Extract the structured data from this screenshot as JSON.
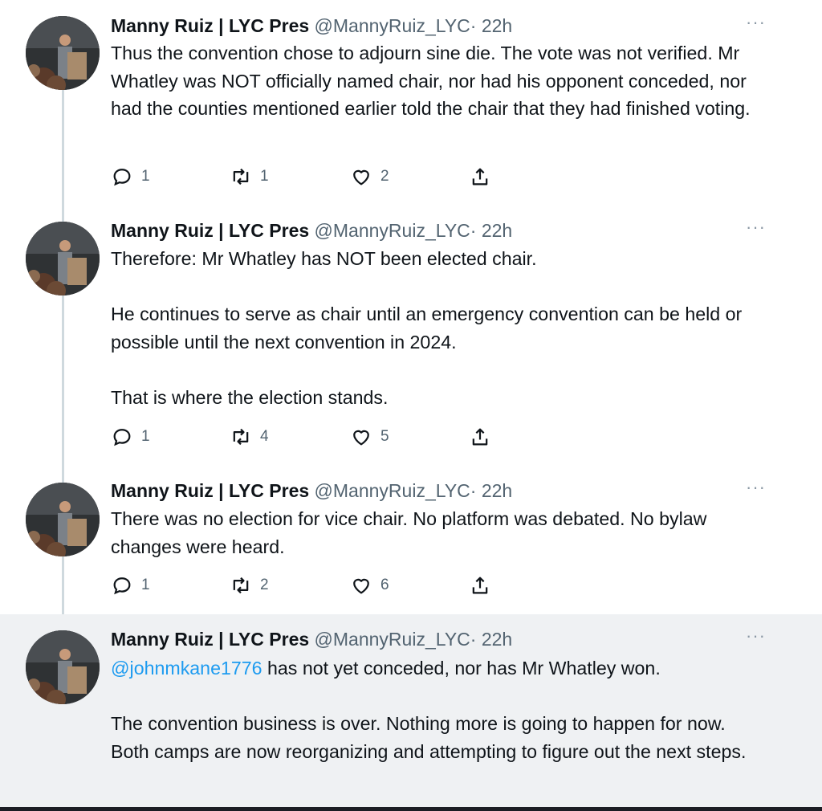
{
  "tweets": [
    {
      "author": "Manny Ruiz | LYC Pres",
      "handle": "@MannyRuiz_LYC",
      "time": "· 22h",
      "paragraphs": [
        "Thus the convention chose to adjourn sine die. The vote was not verified. Mr Whatley was NOT officially named chair, nor had his opponent conceded, nor had the counties mentioned earlier told the chair that they had finished voting."
      ],
      "replies": "1",
      "retweets": "1",
      "likes": "2"
    },
    {
      "author": "Manny Ruiz | LYC Pres",
      "handle": "@MannyRuiz_LYC",
      "time": "· 22h",
      "paragraphs": [
        "Therefore: Mr Whatley has NOT been elected chair.",
        "He continues to serve as chair until an emergency convention can be held or possible until the next convention in 2024.",
        "That is where the election stands."
      ],
      "replies": "1",
      "retweets": "4",
      "likes": "5"
    },
    {
      "author": "Manny Ruiz | LYC Pres",
      "handle": "@MannyRuiz_LYC",
      "time": "· 22h",
      "paragraphs": [
        "There was no election for vice chair. No platform was debated. No bylaw changes were heard."
      ],
      "replies": "1",
      "retweets": "2",
      "likes": "6"
    },
    {
      "author": "Manny Ruiz | LYC Pres",
      "handle": "@MannyRuiz_LYC",
      "time": "· 22h",
      "mention": "@johnmkane1776",
      "paragraphs": [
        " has not yet conceded, nor has Mr Whatley won.",
        "The convention business is over. Nothing more is going to happen for now. Both camps are now reorganizing and attempting to figure out the next steps."
      ]
    }
  ],
  "icons": {
    "more": "more-horizontal-icon",
    "reply": "reply-bubble-icon",
    "retweet": "retweet-arrows-icon",
    "like": "heart-outline-icon",
    "share": "share-upload-icon"
  },
  "colors": {
    "link": "#1d9bf0",
    "muted": "#536471",
    "highlight_bg": "#eff1f3",
    "thread_line": "#cfd9de"
  }
}
